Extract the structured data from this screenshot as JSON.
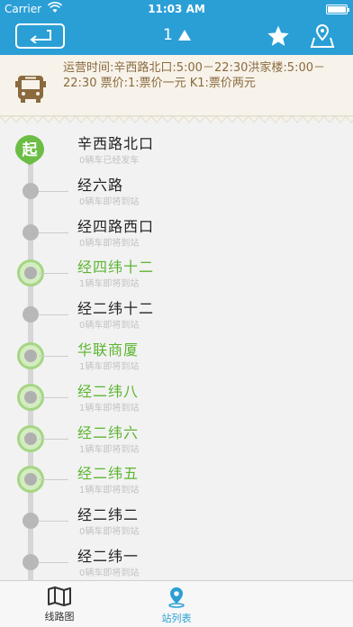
{
  "status": {
    "carrier": "Carrier",
    "time": "11:03 AM"
  },
  "nav": {
    "title": "1"
  },
  "info": {
    "text": "运营时间:辛西路北口:5:00－22:30洪家楼:5:00－22:30 票价:1:票价一元 K1:票价两元"
  },
  "start_badge": "起",
  "stops": [
    {
      "name": "辛西路北口",
      "sub": "0辆车已经发车",
      "active": false,
      "start": true
    },
    {
      "name": "经六路",
      "sub": "0辆车即将到站",
      "active": false
    },
    {
      "name": "经四路西口",
      "sub": "0辆车即将到站",
      "active": false
    },
    {
      "name": "经四纬十二",
      "sub": "1辆车即将到站",
      "active": true
    },
    {
      "name": "经二纬十二",
      "sub": "0辆车即将到站",
      "active": false
    },
    {
      "name": "华联商厦",
      "sub": "1辆车即将到站",
      "active": true
    },
    {
      "name": "经二纬八",
      "sub": "1辆车即将到站",
      "active": true
    },
    {
      "name": "经二纬六",
      "sub": "1辆车即将到站",
      "active": true
    },
    {
      "name": "经二纬五",
      "sub": "1辆车即将到站",
      "active": true
    },
    {
      "name": "经二纬二",
      "sub": "0辆车即将到站",
      "active": false
    },
    {
      "name": "经二纬一",
      "sub": "0辆车即将到站",
      "active": false
    }
  ],
  "tabs": {
    "map": "线路图",
    "list": "站列表"
  },
  "colors": {
    "accent": "#2a9fd6",
    "active_green": "#5cb531",
    "info_text": "#8b6a3e"
  }
}
